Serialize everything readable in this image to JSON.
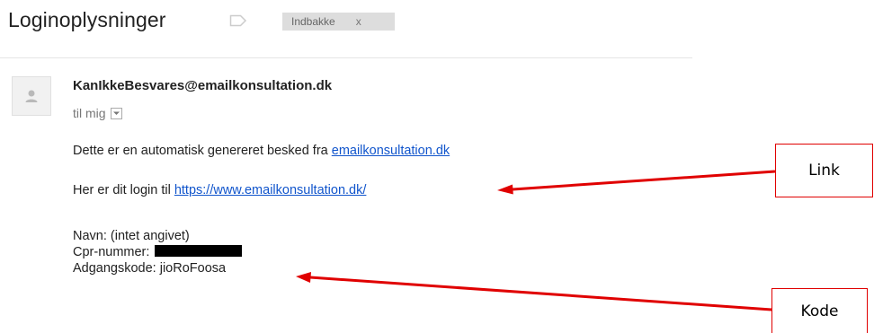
{
  "email": {
    "subject": "Loginoplysninger",
    "label_chip": {
      "text": "Indbakke",
      "remove": "x"
    },
    "sender": "KanIkkeBesvares@emailkonsultation.dk",
    "recipient": "til mig",
    "body": {
      "line1_prefix": "Dette er en automatisk genereret besked fra ",
      "line1_link": "emailkonsultation.dk",
      "line2_prefix": "Her er dit login til ",
      "line2_link": "https://www.emailkonsultation.dk/",
      "name_line": "Navn: (intet angivet)",
      "cpr_label": "Cpr-nummer:",
      "password_line": "Adgangskode: jioRoFoosa"
    }
  },
  "annotations": {
    "link_label": "Link",
    "code_label": "Kode",
    "color": "#e00000"
  },
  "colors": {
    "link": "#1155cc",
    "chip_bg": "#dddddd",
    "redaction": "#000000"
  },
  "icons": {
    "label_tag": "label-tag-icon",
    "avatar": "person-icon",
    "recipient_toggle": "chevron-down-icon"
  }
}
